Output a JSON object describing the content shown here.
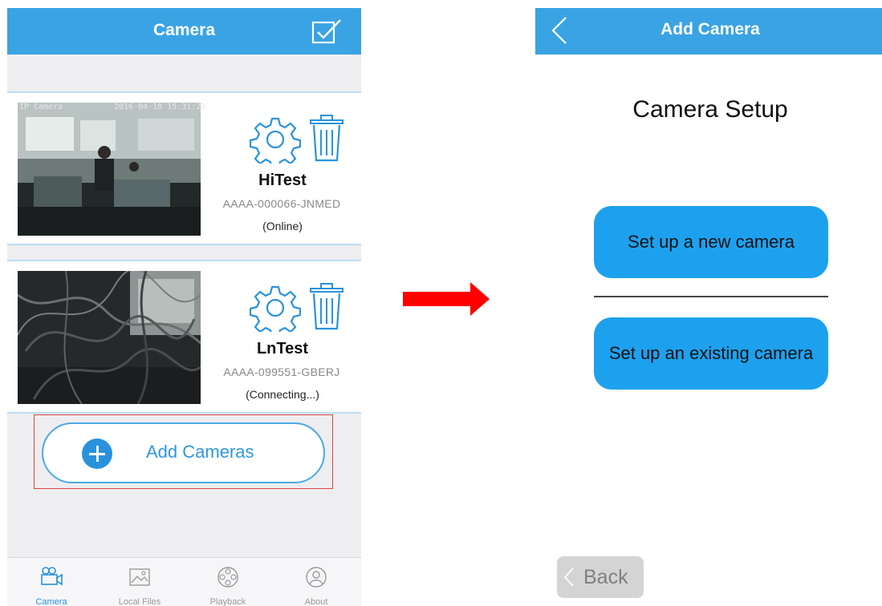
{
  "left_screen": {
    "title": "Camera",
    "cameras": [
      {
        "name": "HiTest",
        "uid": "AAAA-000066-JNMED",
        "status": "(Online)",
        "stamp_name": "IP Camera",
        "stamp_time": "2016-04-18 15:31:23"
      },
      {
        "name": "LnTest",
        "uid": "AAAA-099551-GBERJ",
        "status": "(Connecting...)"
      }
    ],
    "add_button_label": "Add Cameras",
    "tabs": [
      {
        "label": "Camera",
        "icon": "video-camera-icon",
        "active": true
      },
      {
        "label": "Local Files",
        "icon": "image-icon",
        "active": false
      },
      {
        "label": "Playback",
        "icon": "film-reel-icon",
        "active": false
      },
      {
        "label": "About",
        "icon": "person-icon",
        "active": false
      }
    ]
  },
  "right_screen": {
    "title": "Add Camera",
    "heading": "Camera Setup",
    "new_camera_label": "Set up a new camera",
    "existing_camera_label": "Set up an existing camera",
    "back_label": "Back"
  },
  "colors": {
    "nav_blue": "#3aa3e3",
    "button_blue": "#1da1ee",
    "accent_blue": "#2a92dc",
    "highlight_red": "#d84444",
    "arrow_red": "#ff0000"
  }
}
